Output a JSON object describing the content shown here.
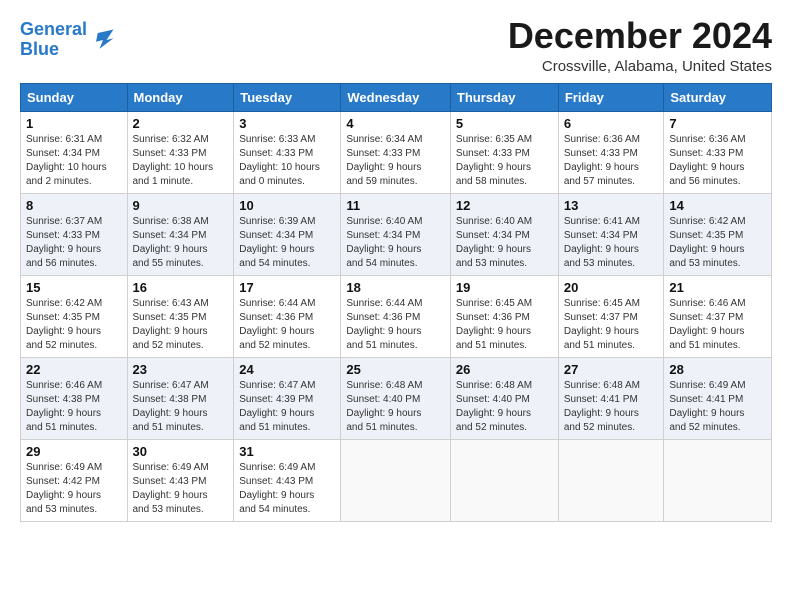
{
  "header": {
    "logo_line1": "General",
    "logo_line2": "Blue",
    "title": "December 2024",
    "subtitle": "Crossville, Alabama, United States"
  },
  "days_of_week": [
    "Sunday",
    "Monday",
    "Tuesday",
    "Wednesday",
    "Thursday",
    "Friday",
    "Saturday"
  ],
  "weeks": [
    [
      {
        "day": "1",
        "info": "Sunrise: 6:31 AM\nSunset: 4:34 PM\nDaylight: 10 hours\nand 2 minutes."
      },
      {
        "day": "2",
        "info": "Sunrise: 6:32 AM\nSunset: 4:33 PM\nDaylight: 10 hours\nand 1 minute."
      },
      {
        "day": "3",
        "info": "Sunrise: 6:33 AM\nSunset: 4:33 PM\nDaylight: 10 hours\nand 0 minutes."
      },
      {
        "day": "4",
        "info": "Sunrise: 6:34 AM\nSunset: 4:33 PM\nDaylight: 9 hours\nand 59 minutes."
      },
      {
        "day": "5",
        "info": "Sunrise: 6:35 AM\nSunset: 4:33 PM\nDaylight: 9 hours\nand 58 minutes."
      },
      {
        "day": "6",
        "info": "Sunrise: 6:36 AM\nSunset: 4:33 PM\nDaylight: 9 hours\nand 57 minutes."
      },
      {
        "day": "7",
        "info": "Sunrise: 6:36 AM\nSunset: 4:33 PM\nDaylight: 9 hours\nand 56 minutes."
      }
    ],
    [
      {
        "day": "8",
        "info": "Sunrise: 6:37 AM\nSunset: 4:33 PM\nDaylight: 9 hours\nand 56 minutes."
      },
      {
        "day": "9",
        "info": "Sunrise: 6:38 AM\nSunset: 4:34 PM\nDaylight: 9 hours\nand 55 minutes."
      },
      {
        "day": "10",
        "info": "Sunrise: 6:39 AM\nSunset: 4:34 PM\nDaylight: 9 hours\nand 54 minutes."
      },
      {
        "day": "11",
        "info": "Sunrise: 6:40 AM\nSunset: 4:34 PM\nDaylight: 9 hours\nand 54 minutes."
      },
      {
        "day": "12",
        "info": "Sunrise: 6:40 AM\nSunset: 4:34 PM\nDaylight: 9 hours\nand 53 minutes."
      },
      {
        "day": "13",
        "info": "Sunrise: 6:41 AM\nSunset: 4:34 PM\nDaylight: 9 hours\nand 53 minutes."
      },
      {
        "day": "14",
        "info": "Sunrise: 6:42 AM\nSunset: 4:35 PM\nDaylight: 9 hours\nand 53 minutes."
      }
    ],
    [
      {
        "day": "15",
        "info": "Sunrise: 6:42 AM\nSunset: 4:35 PM\nDaylight: 9 hours\nand 52 minutes."
      },
      {
        "day": "16",
        "info": "Sunrise: 6:43 AM\nSunset: 4:35 PM\nDaylight: 9 hours\nand 52 minutes."
      },
      {
        "day": "17",
        "info": "Sunrise: 6:44 AM\nSunset: 4:36 PM\nDaylight: 9 hours\nand 52 minutes."
      },
      {
        "day": "18",
        "info": "Sunrise: 6:44 AM\nSunset: 4:36 PM\nDaylight: 9 hours\nand 51 minutes."
      },
      {
        "day": "19",
        "info": "Sunrise: 6:45 AM\nSunset: 4:36 PM\nDaylight: 9 hours\nand 51 minutes."
      },
      {
        "day": "20",
        "info": "Sunrise: 6:45 AM\nSunset: 4:37 PM\nDaylight: 9 hours\nand 51 minutes."
      },
      {
        "day": "21",
        "info": "Sunrise: 6:46 AM\nSunset: 4:37 PM\nDaylight: 9 hours\nand 51 minutes."
      }
    ],
    [
      {
        "day": "22",
        "info": "Sunrise: 6:46 AM\nSunset: 4:38 PM\nDaylight: 9 hours\nand 51 minutes."
      },
      {
        "day": "23",
        "info": "Sunrise: 6:47 AM\nSunset: 4:38 PM\nDaylight: 9 hours\nand 51 minutes."
      },
      {
        "day": "24",
        "info": "Sunrise: 6:47 AM\nSunset: 4:39 PM\nDaylight: 9 hours\nand 51 minutes."
      },
      {
        "day": "25",
        "info": "Sunrise: 6:48 AM\nSunset: 4:40 PM\nDaylight: 9 hours\nand 51 minutes."
      },
      {
        "day": "26",
        "info": "Sunrise: 6:48 AM\nSunset: 4:40 PM\nDaylight: 9 hours\nand 52 minutes."
      },
      {
        "day": "27",
        "info": "Sunrise: 6:48 AM\nSunset: 4:41 PM\nDaylight: 9 hours\nand 52 minutes."
      },
      {
        "day": "28",
        "info": "Sunrise: 6:49 AM\nSunset: 4:41 PM\nDaylight: 9 hours\nand 52 minutes."
      }
    ],
    [
      {
        "day": "29",
        "info": "Sunrise: 6:49 AM\nSunset: 4:42 PM\nDaylight: 9 hours\nand 53 minutes."
      },
      {
        "day": "30",
        "info": "Sunrise: 6:49 AM\nSunset: 4:43 PM\nDaylight: 9 hours\nand 53 minutes."
      },
      {
        "day": "31",
        "info": "Sunrise: 6:49 AM\nSunset: 4:43 PM\nDaylight: 9 hours\nand 54 minutes."
      },
      {
        "day": "",
        "info": ""
      },
      {
        "day": "",
        "info": ""
      },
      {
        "day": "",
        "info": ""
      },
      {
        "day": "",
        "info": ""
      }
    ]
  ]
}
